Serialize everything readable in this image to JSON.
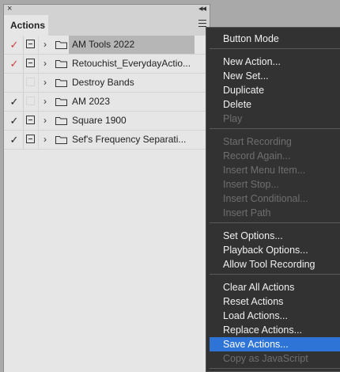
{
  "panel": {
    "close_glyph": "×",
    "collapse_glyph": "◂◂",
    "tab_label": "Actions",
    "sets": [
      {
        "check": "✓",
        "check_color": "#d43c3c",
        "dialog": true,
        "name": "AM Tools 2022",
        "selected": true
      },
      {
        "check": "✓",
        "check_color": "#d43c3c",
        "dialog": true,
        "name": "Retouchist_EverydayActio...",
        "selected": false
      },
      {
        "check": "",
        "check_color": "#222222",
        "dialog": false,
        "name": "Destroy Bands",
        "selected": false
      },
      {
        "check": "✓",
        "check_color": "#222222",
        "dialog": false,
        "name": "AM 2023",
        "selected": false
      },
      {
        "check": "✓",
        "check_color": "#222222",
        "dialog": true,
        "name": "Square 1900",
        "selected": false
      },
      {
        "check": "✓",
        "check_color": "#222222",
        "dialog": true,
        "name": "Sef's Frequency Separati...",
        "selected": false
      }
    ]
  },
  "menu": {
    "items": [
      {
        "label": "Button Mode",
        "enabled": true
      },
      {
        "label": "New Action...",
        "enabled": true
      },
      {
        "label": "New Set...",
        "enabled": true
      },
      {
        "label": "Duplicate",
        "enabled": true
      },
      {
        "label": "Delete",
        "enabled": true
      },
      {
        "label": "Play",
        "enabled": false
      },
      {
        "label": "Start Recording",
        "enabled": false
      },
      {
        "label": "Record Again...",
        "enabled": false
      },
      {
        "label": "Insert Menu Item...",
        "enabled": false
      },
      {
        "label": "Insert Stop...",
        "enabled": false
      },
      {
        "label": "Insert Conditional...",
        "enabled": false
      },
      {
        "label": "Insert Path",
        "enabled": false
      },
      {
        "label": "Set Options...",
        "enabled": true
      },
      {
        "label": "Playback Options...",
        "enabled": true
      },
      {
        "label": "Allow Tool Recording",
        "enabled": true
      },
      {
        "label": "Clear All Actions",
        "enabled": true
      },
      {
        "label": "Reset Actions",
        "enabled": true
      },
      {
        "label": "Load Actions...",
        "enabled": true
      },
      {
        "label": "Replace Actions...",
        "enabled": true
      },
      {
        "label": "Save Actions...",
        "enabled": true,
        "highlighted": true
      },
      {
        "label": "Copy as JavaScript",
        "enabled": false
      }
    ]
  },
  "colors": {
    "highlight": "#2e74d6",
    "menu_bg": "#323232",
    "panel_bg": "#e6e6e6",
    "selected_row": "#b6b6b6"
  }
}
